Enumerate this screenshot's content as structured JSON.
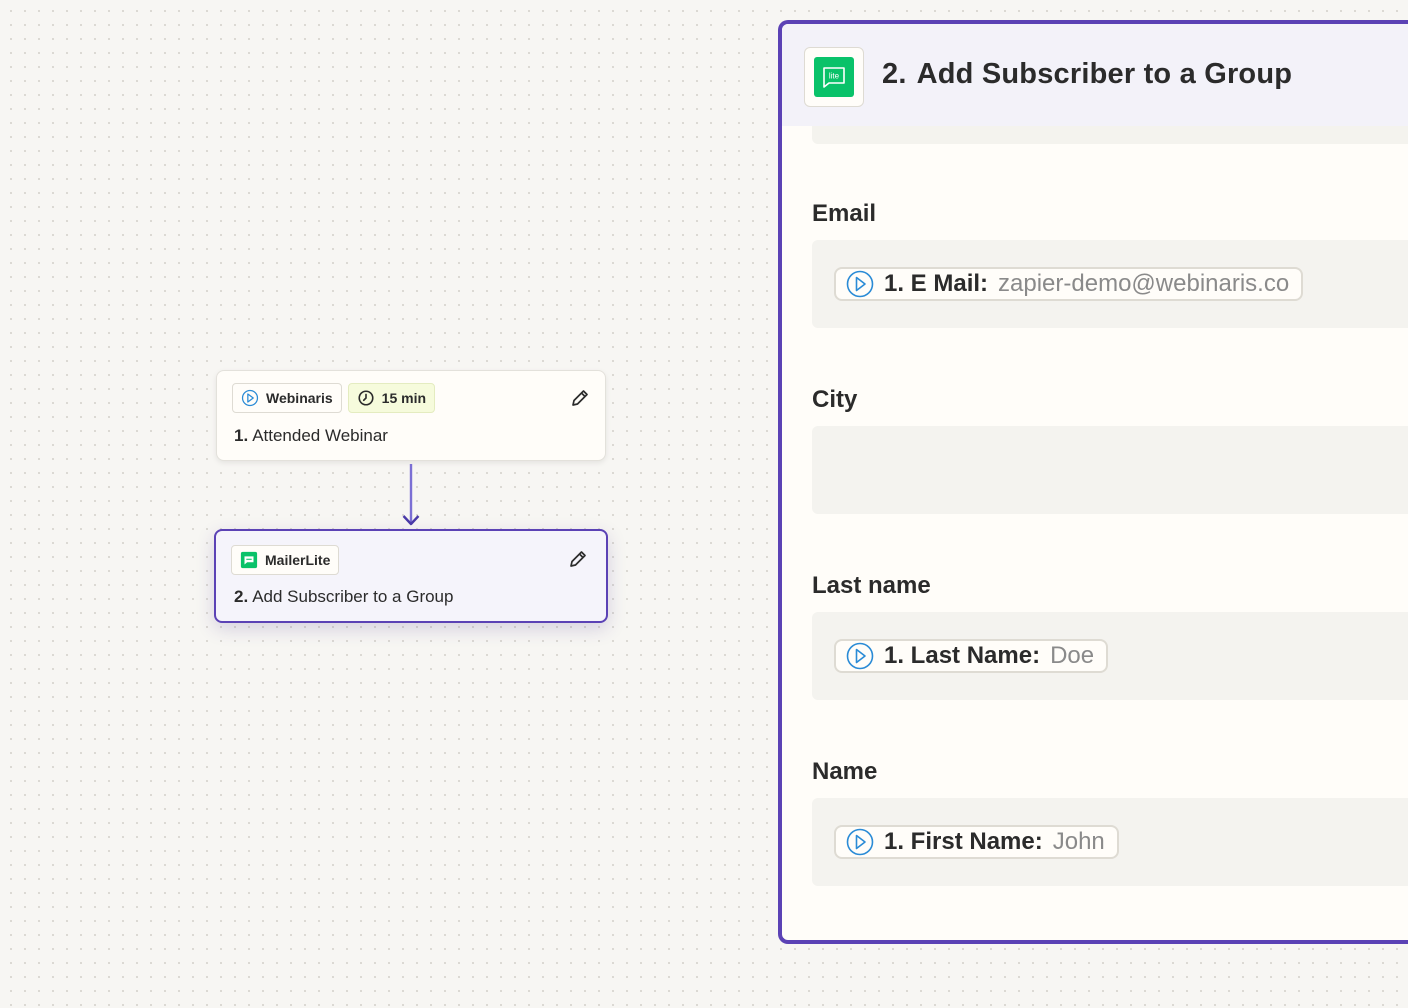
{
  "canvas": {
    "trigger_step": {
      "app_name": "Webinaris",
      "schedule": "15 min",
      "number": "1.",
      "title": "Attended Webinar"
    },
    "action_step": {
      "app_name": "MailerLite",
      "number": "2.",
      "title": "Add Subscriber to a Group"
    }
  },
  "panel": {
    "number": "2.",
    "title": "Add Subscriber to a Group",
    "app_icon_text": "lite",
    "fields": {
      "email": {
        "label": "Email",
        "token_label": "1. E Mail:",
        "token_value": "zapier-demo@webinaris.co"
      },
      "city": {
        "label": "City"
      },
      "last_name": {
        "label": "Last name",
        "token_label": "1. Last Name:",
        "token_value": "Doe"
      },
      "name": {
        "label": "Name",
        "token_label": "1. First Name:",
        "token_value": "John"
      }
    }
  },
  "colors": {
    "accent": "#5b42b5",
    "mailerlite_green": "#09c269",
    "webinaris_blue": "#2a8bd6",
    "canvas_bg": "#f7f6f3"
  },
  "icons": [
    "webinaris-icon",
    "clock-icon",
    "pencil-icon",
    "mailerlite-icon",
    "arrow-down-icon"
  ]
}
